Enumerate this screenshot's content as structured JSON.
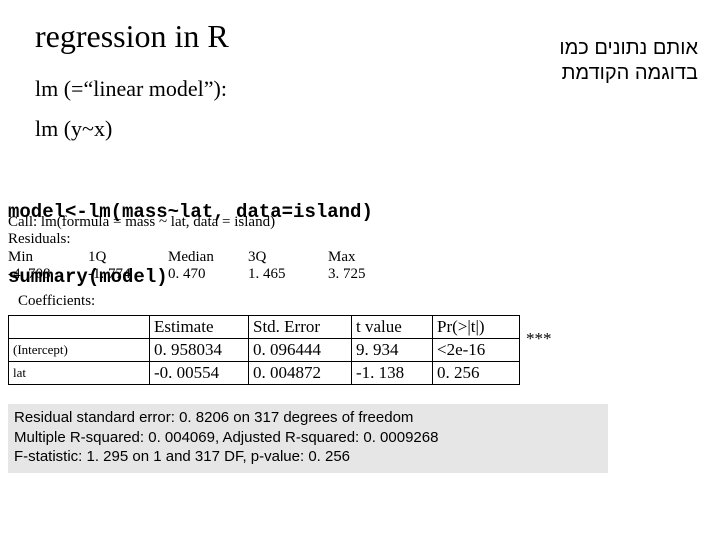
{
  "title": "regression in R",
  "subtitle1": "lm (=“linear model”):",
  "subtitle2": "lm (y~x)",
  "hebrew": {
    "line1": "אותם נתונים כמו",
    "line2": "בדוגמה הקודמת"
  },
  "code": {
    "line1": "model<-lm(mass~lat, data=island)",
    "line2": "summary(model)"
  },
  "call": {
    "line1": "Call: lm(formula = mass ~ lat, data = island)",
    "line2": "Residuals:",
    "headers": {
      "h1": "Min",
      "h2": "1Q",
      "h3": "Median",
      "h4": "3Q",
      "h5": "Max"
    },
    "values": {
      "v1": "-4. 708",
      "v2": "-1. 774",
      "v3": "0. 470",
      "v4": "1. 465",
      "v5": "3. 725"
    }
  },
  "coef_label": "Coefficients:",
  "coef": {
    "h_estimate": "Estimate",
    "h_se": "Std. Error",
    "h_t": "t value",
    "h_p": "Pr(>|t|)",
    "rows": [
      {
        "name": "(Intercept)",
        "est": "0. 958034",
        "se": "0. 096444",
        "t": "9. 934",
        "p": "<2e-16",
        "stars": "***"
      },
      {
        "name": "lat",
        "est": "-0. 00554",
        "se": "0. 004872",
        "t": "-1. 138",
        "p": "0. 256",
        "stars": ""
      }
    ]
  },
  "footer": {
    "l1": "Residual standard error: 0. 8206 on 317 degrees of freedom",
    "l2": "Multiple R-squared: 0. 004069, Adjusted R-squared: 0. 0009268",
    "l3": "F-statistic: 1. 295 on 1 and 317 DF, p-value: 0. 256"
  }
}
